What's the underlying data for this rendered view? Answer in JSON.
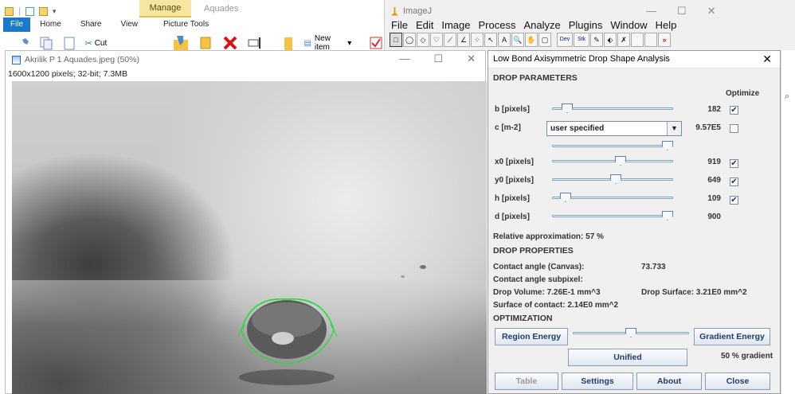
{
  "explorer": {
    "contextual_tab": "Manage",
    "window_title": "Aquades",
    "tabs": [
      "File",
      "Home",
      "Share",
      "View",
      "Picture Tools"
    ],
    "cut_label": "Cut",
    "new_item_label": "New item",
    "new_item_caret": "▾"
  },
  "imagej": {
    "title": "ImageJ",
    "menus": [
      "File",
      "Edit",
      "Image",
      "Process",
      "Analyze",
      "Plugins",
      "Window",
      "Help"
    ],
    "tool_glyphs": [
      "□",
      "◯",
      "◇",
      "♡",
      "⟋",
      "∠",
      "⁘",
      "↖",
      "A",
      "🔍",
      "✋",
      "▢",
      "Dev",
      "Stk",
      "✎",
      "⬖",
      "✗",
      " ",
      " ",
      "»"
    ],
    "window_buttons": [
      "—",
      "☐",
      "✕"
    ]
  },
  "image_window": {
    "title": "Akrilik P 1 Aquades.jpeg (50%)",
    "info": "1600x1200 pixels; 32-bit; 7.3MB",
    "window_buttons": [
      "—",
      "☐",
      "✕"
    ]
  },
  "outer_window_buttons": [
    "—",
    "☐",
    "✕"
  ],
  "dialog": {
    "title": "Low Bond Axisymmetric Drop Shape Analysis",
    "close_glyph": "✕",
    "section_params": "DROP PARAMETERS",
    "optimize_header": "Optimize",
    "params": [
      {
        "label": "b [pixels]",
        "value": "182",
        "slider_fraction": 0.09,
        "checked": true
      },
      {
        "label": "x0 [pixels]",
        "value": "919",
        "slider_fraction": 0.57,
        "checked": true
      },
      {
        "label": "y0 [pixels]",
        "value": "649",
        "slider_fraction": 0.53,
        "checked": true
      },
      {
        "label": "h [pixels]",
        "value": "109",
        "slider_fraction": 0.07,
        "checked": true
      },
      {
        "label": "d [pixels]",
        "value": "900",
        "slider_fraction": 1.0,
        "checked": null
      }
    ],
    "c_param": {
      "label": "c [m-2]",
      "combo_value": "user specified",
      "value": "9.57E5",
      "checked": false,
      "slider_fraction": 1.0
    },
    "check_glyph": "✔",
    "combo_arrow": "▼",
    "relative_approx": "Relative approximation: 57 %",
    "section_props": "DROP PROPERTIES",
    "contact_angle_canvas_label": "Contact angle (Canvas):",
    "contact_angle_canvas_value": "73.733",
    "contact_angle_subpixel_label": "Contact angle subpixel:",
    "drop_volume": "Drop Volume: 7.26E-1 mm^3",
    "drop_surface": "Drop Surface: 3.21E0 mm^2",
    "surface_contact": "Surface of contact: 2.14E0 mm^2",
    "section_opt": "OPTIMIZATION",
    "region_energy": "Region Energy",
    "gradient_energy": "Gradient Energy",
    "opt_slider_fraction": 0.5,
    "unified": "Unified",
    "gradient_pct": "50 % gradient",
    "buttons": [
      "Table",
      "Settings",
      "About",
      "Close"
    ]
  },
  "icons": {
    "ribbon": [
      "pin-icon",
      "copy-icon",
      "paste-icon",
      "cut-icon",
      "folder-move-icon",
      "copy-to-icon",
      "delete-icon",
      "rename-icon",
      "new-folder-icon",
      "new-item-icon",
      "select-icon"
    ],
    "side_search": "search-icon"
  },
  "colors": {
    "file_tab": "#1979ca",
    "contextual_tab": "#f7e6a1",
    "delete_red": "#d11",
    "drop_outline": "#22dd33",
    "button_text": "#1e3c6f"
  }
}
